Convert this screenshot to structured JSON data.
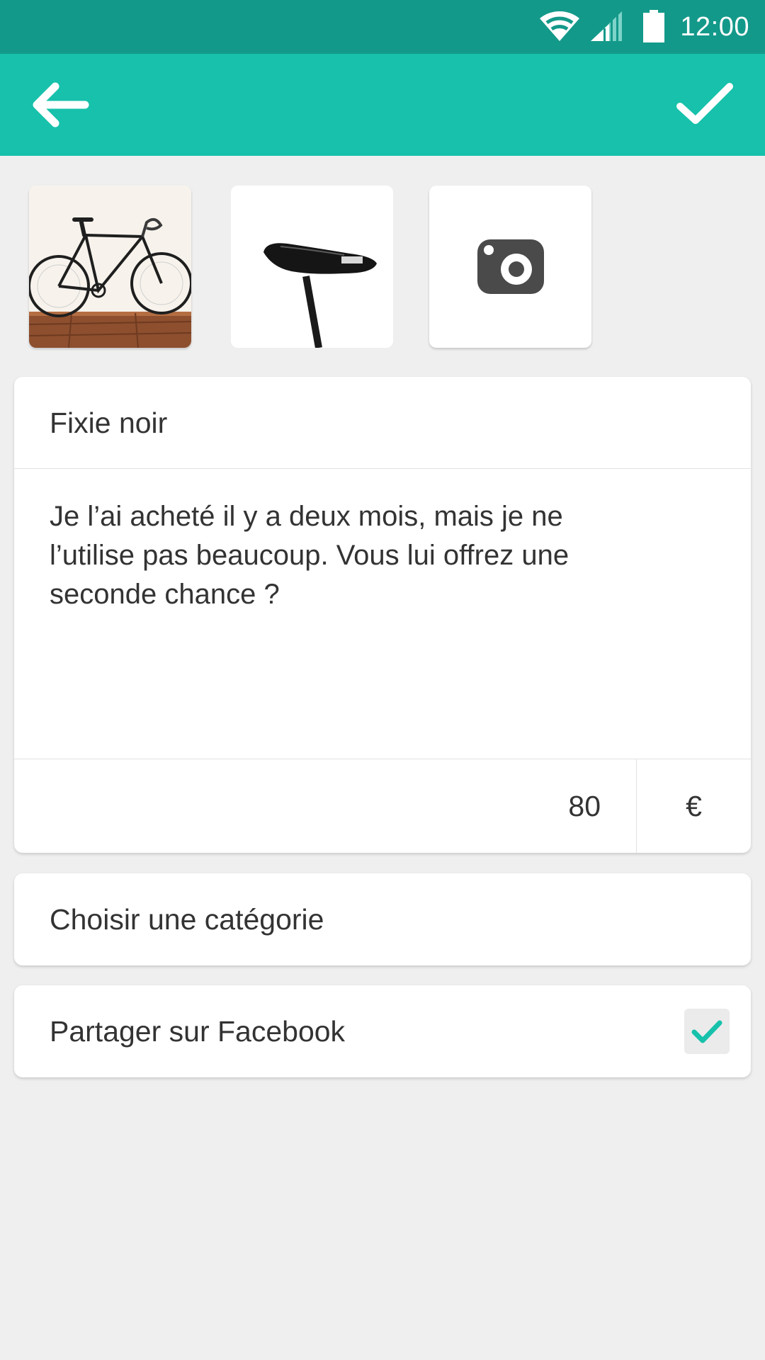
{
  "status_bar": {
    "time": "12:00",
    "icons": [
      "wifi-icon",
      "cell-signal-icon",
      "battery-icon"
    ],
    "background": "#13998a"
  },
  "app_bar": {
    "background": "#17c1ab",
    "back_icon": "arrow-left-icon",
    "confirm_icon": "check-icon"
  },
  "photos": [
    {
      "name": "photo-bicycle",
      "depicts": "black fixie bicycle on wooden floor"
    },
    {
      "name": "photo-saddle",
      "depicts": "black bicycle saddle"
    },
    {
      "name": "add-photo",
      "icon": "camera-icon"
    }
  ],
  "listing": {
    "title": "Fixie noir",
    "description": "Je l’ai acheté il y a deux mois, mais je ne l’utilise pas beaucoup. Vous lui offrez une seconde chance ?",
    "price": "80",
    "currency": "€"
  },
  "category": {
    "label": "Choisir une catégorie"
  },
  "share": {
    "label": "Partager sur Facebook",
    "checked": true,
    "check_color": "#17c1ab"
  }
}
